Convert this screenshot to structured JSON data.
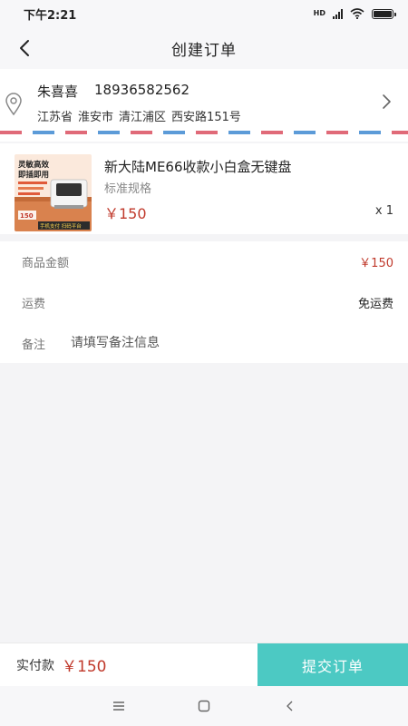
{
  "status_bar": {
    "time": "下午2:21",
    "network_label": "HD",
    "battery": 1.0
  },
  "header": {
    "title": "创建订单",
    "back_icon": "chevron-left-icon"
  },
  "address": {
    "name": "朱喜喜",
    "phone": "18936582562",
    "province": "江苏省",
    "city": "淮安市",
    "district": "清江浦区",
    "street": "西安路151号",
    "pin_icon": "location-pin-icon",
    "arrow_icon": "chevron-right-icon"
  },
  "product": {
    "title": "新大陆ME66收款小白盒无键盘",
    "spec": "标准规格",
    "price": "￥150",
    "quantity": "x 1",
    "thumbnail": {
      "headline1": "灵敏高效",
      "headline2": "即插即用",
      "price_tag": "150",
      "banner": "手机支付 扫码平台"
    }
  },
  "summary": {
    "goods_amount_label": "商品金额",
    "goods_amount_value": "￥150",
    "shipping_label": "运费",
    "shipping_value": "免运费",
    "note_label": "备注",
    "note_placeholder": "请填写备注信息"
  },
  "footer": {
    "pay_label": "实付款",
    "pay_amount": "￥150",
    "submit_label": "提交订单"
  },
  "colors": {
    "accent": "#4cc9c3",
    "price_red": "#c0392b",
    "airmail_red": "#e06a78",
    "airmail_blue": "#5c9bd8"
  },
  "system_nav": {
    "menu_icon": "menu-icon",
    "home_icon": "home-square-icon",
    "back_icon": "back-triangle-icon"
  }
}
